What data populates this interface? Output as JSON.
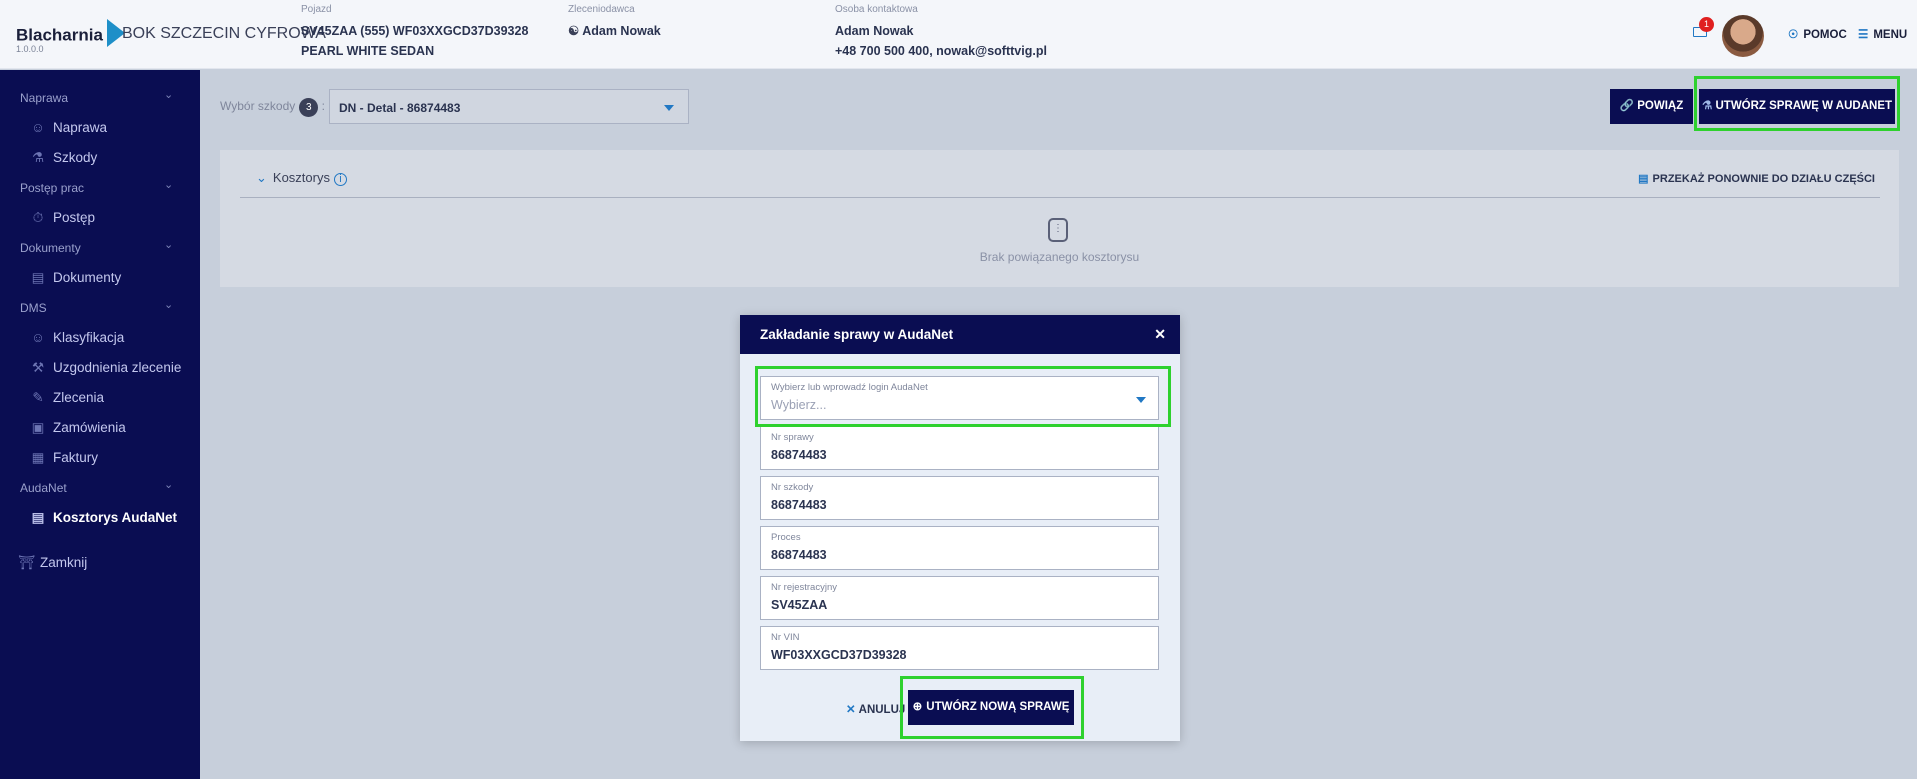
{
  "app": {
    "name": "Blacharnia",
    "version": "1.0.0.0",
    "location": "BOK SZCZECIN CYFROWA"
  },
  "header": {
    "pojazd": {
      "label": "Pojazd",
      "line1": "SV45ZAA (555) WF03XXGCD37D39328",
      "line2": "PEARL WHITE SEDAN"
    },
    "zleceniodawca": {
      "label": "Zleceniodawca",
      "value": "Adam Nowak"
    },
    "kontakt": {
      "label": "Osoba kontaktowa",
      "line1": "Adam Nowak",
      "line2": "+48 700 500 400, nowak@softtvig.pl"
    },
    "notifications": "1",
    "help": "POMOC",
    "menu": "MENU"
  },
  "sidebar": {
    "sections": [
      {
        "label": "Naprawa",
        "items": [
          {
            "label": "Naprawa",
            "icon": "user-icon"
          },
          {
            "label": "Szkody",
            "icon": "car-damage-icon"
          }
        ]
      },
      {
        "label": "Postęp prac",
        "items": [
          {
            "label": "Postęp",
            "icon": "timer-icon"
          }
        ]
      },
      {
        "label": "Dokumenty",
        "items": [
          {
            "label": "Dokumenty",
            "icon": "document-icon"
          }
        ]
      },
      {
        "label": "DMS",
        "items": [
          {
            "label": "Klasyfikacja",
            "icon": "user-icon"
          },
          {
            "label": "Uzgodnienia zlecenie",
            "icon": "tools-icon"
          },
          {
            "label": "Zlecenia",
            "icon": "edit-icon"
          },
          {
            "label": "Zamówienia",
            "icon": "cart-icon"
          },
          {
            "label": "Faktury",
            "icon": "invoice-icon"
          }
        ]
      },
      {
        "label": "AudaNet",
        "items": [
          {
            "label": "Kosztorys AudaNet",
            "icon": "document-icon"
          }
        ]
      }
    ],
    "close": "Zamknij"
  },
  "toolbar": {
    "wybor_label": "Wybór szkody",
    "wybor_count": "3",
    "wybor_value": "DN - Detal - 86874483",
    "powiaz": "POWIĄZ",
    "utworz": "UTWÓRZ SPRAWĘ W AUDANET"
  },
  "panel": {
    "title": "Kosztorys",
    "przekaz": "PRZEKAŻ PONOWNIE DO DZIAŁU CZĘŚCI",
    "empty": "Brak powiązanego kosztorysu"
  },
  "modal": {
    "title": "Zakładanie sprawy w AudaNet",
    "login_label": "Wybierz lub wprowadź login AudaNet",
    "login_placeholder": "Wybierz...",
    "fields": [
      {
        "label": "Nr sprawy",
        "value": "86874483"
      },
      {
        "label": "Nr szkody",
        "value": "86874483"
      },
      {
        "label": "Proces",
        "value": "86874483"
      },
      {
        "label": "Nr rejestracyjny",
        "value": "SV45ZAA"
      },
      {
        "label": "Nr VIN",
        "value": "WF03XXGCD37D39328"
      }
    ],
    "cancel": "ANULUJ",
    "create": "UTWÓRZ NOWĄ SPRAWĘ"
  },
  "colors": {
    "navy": "#0a0d52",
    "accent": "#2178c4",
    "highlight": "#2ed12e"
  }
}
